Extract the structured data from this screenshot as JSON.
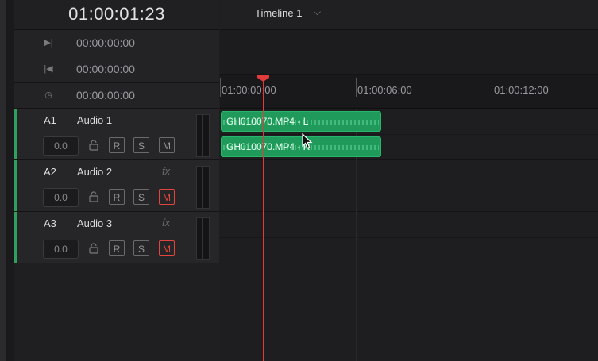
{
  "header": {
    "timecode": "01:00:01:23"
  },
  "timecode_rows": [
    {
      "icon": "jump-to-end-icon",
      "glyph": "▶|",
      "value": "00:00:00:00"
    },
    {
      "icon": "jump-to-start-icon",
      "glyph": "|◀",
      "value": "00:00:00:00"
    },
    {
      "icon": "clock-icon",
      "glyph": "◷",
      "value": "00:00:00:00"
    }
  ],
  "timeline": {
    "title": "Timeline 1",
    "chevron": "⌵"
  },
  "ruler": {
    "labels": [
      "01:00:00:00",
      "01:00:06:00",
      "01:00:12:00"
    ]
  },
  "tracks": [
    {
      "num": "A1",
      "name": "Audio 1",
      "fx": "",
      "volume": "0.0",
      "r": "R",
      "s": "S",
      "m": "M",
      "muted": false
    },
    {
      "num": "A2",
      "name": "Audio 2",
      "fx": "fx",
      "volume": "0.0",
      "r": "R",
      "s": "S",
      "m": "M",
      "muted": true
    },
    {
      "num": "A3",
      "name": "Audio 3",
      "fx": "fx",
      "volume": "0.0",
      "r": "R",
      "s": "S",
      "m": "M",
      "muted": true
    }
  ],
  "clips": [
    {
      "label": "GH010070.MP4 - L"
    },
    {
      "label": "GH010070.MP4 - R"
    }
  ],
  "colors": {
    "accent_green": "#2fa15f",
    "playhead": "#e23b3b",
    "mute_active": "#e2453b",
    "clip": "#1f9a5a"
  }
}
